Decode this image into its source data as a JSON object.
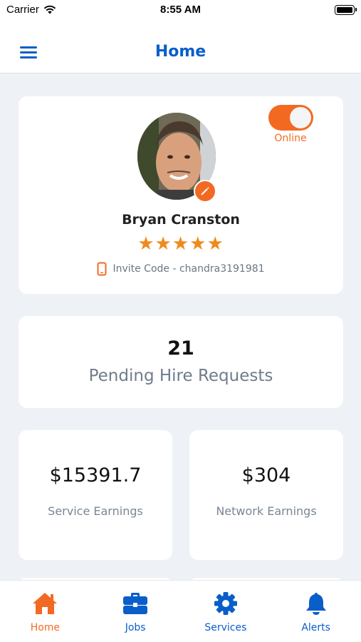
{
  "status_bar": {
    "carrier": "Carrier",
    "time": "8:55 AM"
  },
  "nav": {
    "title": "Home",
    "menu_icon": "hamburger-menu-icon"
  },
  "profile": {
    "name": "Bryan Cranston",
    "rating": 5,
    "stars": "★★★★★",
    "invite_text": "Invite Code - chandra3191981",
    "online_label": "Online",
    "online": true
  },
  "pending": {
    "count": "21",
    "label": "Pending Hire Requests"
  },
  "earnings": {
    "service": {
      "value": "$15391.7",
      "label": "Service Earnings"
    },
    "network": {
      "value": "$304",
      "label": "Network Earnings"
    }
  },
  "tabs": [
    {
      "label": "Home",
      "icon": "home-icon",
      "active": true
    },
    {
      "label": "Jobs",
      "icon": "briefcase-icon",
      "active": false
    },
    {
      "label": "Services",
      "icon": "gear-icon",
      "active": false
    },
    {
      "label": "Alerts",
      "icon": "bell-icon",
      "active": false
    }
  ],
  "colors": {
    "accent": "#f26a22",
    "primary": "#0a5ec9",
    "background": "#eef1f5"
  }
}
